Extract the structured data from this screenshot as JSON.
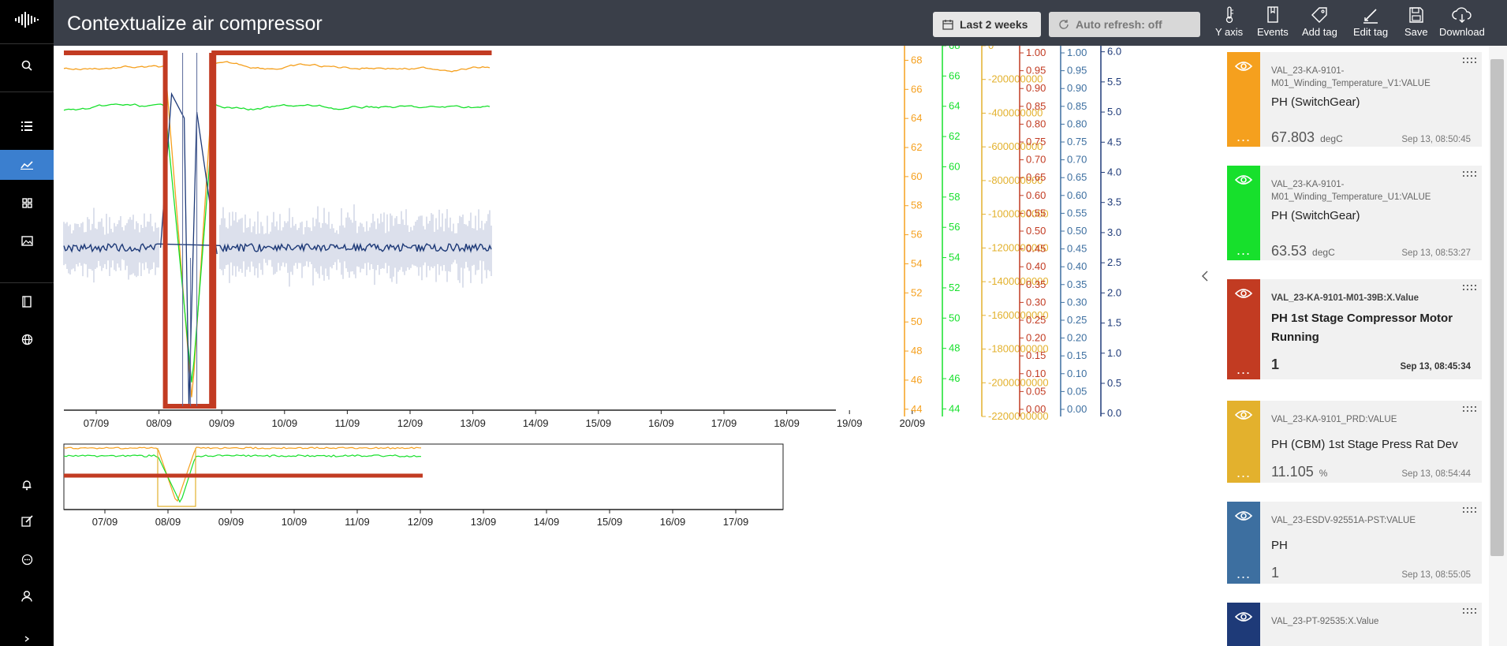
{
  "app": {
    "title": "Contextualize air compressor"
  },
  "toolbar": {
    "range_label": "Last 2 weeks",
    "refresh_label": "Auto refresh: off",
    "tools": [
      {
        "label": "Y axis",
        "icon": "thermometer-icon"
      },
      {
        "label": "Events",
        "icon": "bookmark-icon"
      },
      {
        "label": "Add tag",
        "icon": "tag-icon"
      },
      {
        "label": "Edit tag",
        "icon": "pencil-icon"
      },
      {
        "label": "Save",
        "icon": "save-icon"
      },
      {
        "label": "Download",
        "icon": "cloud-download-icon"
      }
    ]
  },
  "nav": {
    "items": [
      {
        "icon": "logo-icon"
      },
      {
        "icon": "search-icon"
      },
      {
        "icon": "list-icon"
      },
      {
        "icon": "line-chart-icon",
        "active": true
      },
      {
        "icon": "grid-icon"
      },
      {
        "icon": "image-icon"
      },
      {
        "icon": "book-icon"
      },
      {
        "icon": "globe-icon"
      },
      {
        "icon": "bell-icon"
      },
      {
        "icon": "edit-icon"
      },
      {
        "icon": "chat-icon"
      },
      {
        "icon": "user-icon"
      }
    ]
  },
  "colors": {
    "orange": "#f5a01e",
    "green": "#17e02c",
    "red": "#c23b22",
    "gold": "#e3b12d",
    "steel": "#3d6fa0",
    "navy": "#1e3a78",
    "navbar": "#000000",
    "topbar": "#3a3f49",
    "accent": "#3b7fcf"
  },
  "chart_data": [
    {
      "type": "line",
      "xticks": [
        "07/09",
        "08/09",
        "09/09",
        "10/09",
        "11/09",
        "12/09",
        "13/09",
        "14/09",
        "15/09",
        "16/09",
        "17/09",
        "18/09",
        "19/09",
        "20/09"
      ],
      "x_range": [
        "06/09 08:00",
        "20/09 12:00"
      ],
      "y_axes": [
        {
          "color": "#f5a01e",
          "range": [
            43.5,
            69
          ],
          "ticks": [
            44,
            46,
            48,
            50,
            52,
            54,
            56,
            58,
            60,
            62,
            64,
            66,
            68
          ]
        },
        {
          "color": "#17e02c",
          "range": [
            43.5,
            68
          ],
          "ticks": [
            44,
            46,
            48,
            50,
            52,
            54,
            56,
            58,
            60,
            62,
            64,
            66,
            68
          ]
        },
        {
          "color": "#e3b12d",
          "range": [
            -2200000000,
            0
          ],
          "ticks": [
            "0",
            "-200000000",
            "-400000000",
            "-600000000",
            "-800000000",
            "-1000000000",
            "-1200000000",
            "-1400000000",
            "-1600000000",
            "-1800000000",
            "-2000000000",
            "-2200000000"
          ]
        },
        {
          "color": "#c23b22",
          "range": [
            -0.02,
            1.02
          ],
          "ticks": [
            "0.00",
            "0.05",
            "0.10",
            "0.15",
            "0.20",
            "0.25",
            "0.30",
            "0.35",
            "0.40",
            "0.45",
            "0.50",
            "0.55",
            "0.60",
            "0.65",
            "0.70",
            "0.75",
            "0.80",
            "0.85",
            "0.90",
            "0.95",
            "1.00"
          ]
        },
        {
          "color": "#3d6fa0",
          "range": [
            -0.02,
            1.02
          ],
          "ticks": [
            "0.00",
            "0.05",
            "0.10",
            "0.15",
            "0.20",
            "0.25",
            "0.30",
            "0.35",
            "0.40",
            "0.45",
            "0.50",
            "0.55",
            "0.60",
            "0.65",
            "0.70",
            "0.75",
            "0.80",
            "0.85",
            "0.90",
            "0.95",
            "1.00"
          ]
        },
        {
          "color": "#1e3a78",
          "range": [
            -0.05,
            6.1
          ],
          "ticks": [
            "0.0",
            "0.5",
            "1.0",
            "1.5",
            "2.0",
            "2.5",
            "3.0",
            "3.5",
            "4.0",
            "4.5",
            "5.0",
            "5.5",
            "6.0"
          ]
        }
      ],
      "series": [
        {
          "color": "#f5a01e",
          "axis": 0,
          "base": 67.5,
          "drop_to": 44.5
        },
        {
          "color": "#17e02c",
          "axis": 1,
          "base": 63.8,
          "drop_to": 45.5
        },
        {
          "color": "#c23b22",
          "axis": 3,
          "values_on": 1.0,
          "values_off": 0.0
        },
        {
          "color": "#1e3a78",
          "axis": 5,
          "base": 2.75
        }
      ],
      "events": [
        {
          "from": "08/09 01:00",
          "to": "08/09 20:00",
          "state": "off"
        }
      ],
      "data_end": "13/09 08:00"
    },
    {
      "type": "line",
      "role": "overview",
      "xticks": [
        "07/09",
        "08/09",
        "09/09",
        "10/09",
        "11/09",
        "12/09",
        "13/09",
        "14/09",
        "15/09",
        "16/09",
        "17/09"
      ]
    }
  ],
  "tags": [
    {
      "color": "#f5a01e",
      "tag": "VAL_23-KA-9101-M01_Winding_Temperature_V1:VALUE",
      "description": "PH (SwitchGear)",
      "value": "67.803",
      "unit": "degC",
      "timestamp": "Sep 13, 08:50:45",
      "bold": false
    },
    {
      "color": "#17e02c",
      "tag": "VAL_23-KA-9101-M01_Winding_Temperature_U1:VALUE",
      "description": "PH (SwitchGear)",
      "value": "63.53",
      "unit": "degC",
      "timestamp": "Sep 13, 08:53:27",
      "bold": false
    },
    {
      "color": "#c23b22",
      "tag": "VAL_23-KA-9101-M01-39B:X.Value",
      "description": "PH 1st Stage Compressor Motor Running",
      "value": "1",
      "unit": "",
      "timestamp": "Sep 13, 08:45:34",
      "bold": true
    },
    {
      "color": "#e3b12d",
      "tag": "VAL_23-KA-9101_PRD:VALUE",
      "description": "PH (CBM) 1st Stage Press Rat Dev",
      "value": "11.105",
      "unit": "%",
      "timestamp": "Sep 13, 08:54:44",
      "bold": false
    },
    {
      "color": "#3d6fa0",
      "tag": "VAL_23-ESDV-92551A-PST:VALUE",
      "description": "PH",
      "value": "1",
      "unit": "",
      "timestamp": "Sep 13, 08:55:05",
      "bold": false
    },
    {
      "color": "#1e3a78",
      "tag": "VAL_23-PT-92535:X.Value",
      "description": "",
      "value": "",
      "unit": "",
      "timestamp": "",
      "bold": false
    }
  ]
}
